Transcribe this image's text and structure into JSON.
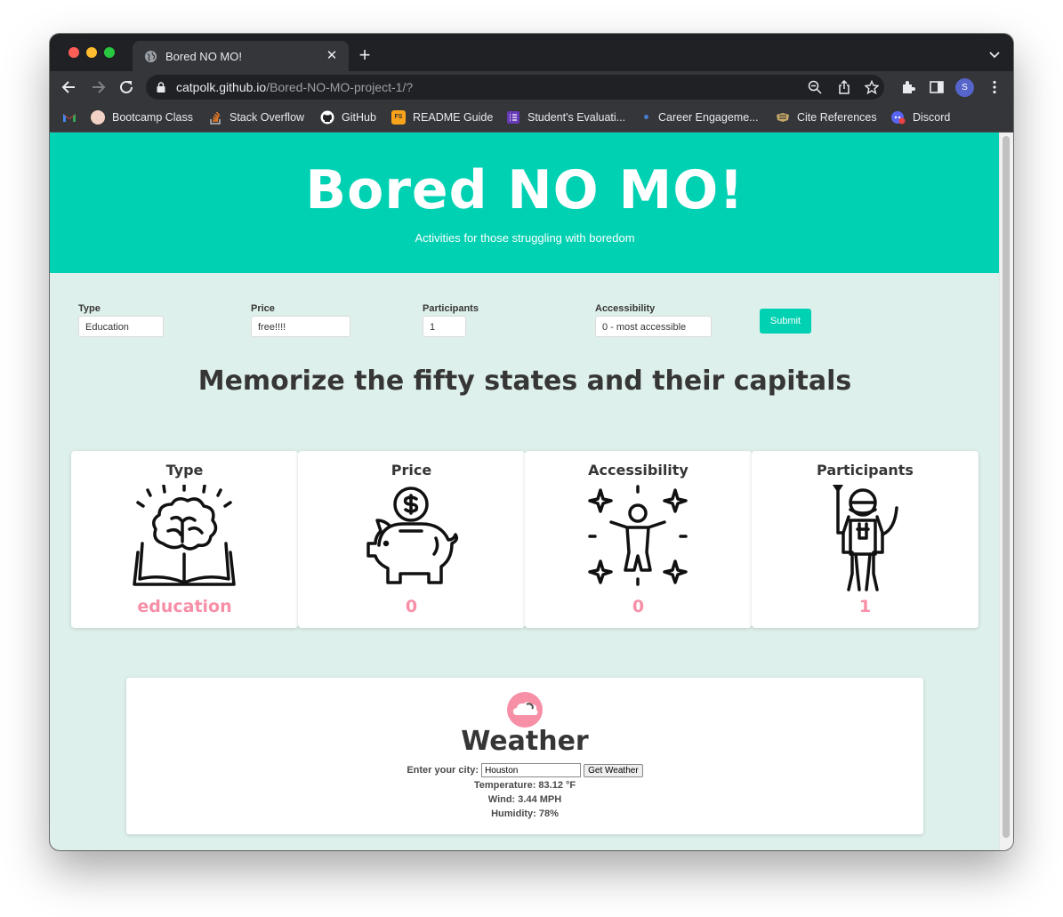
{
  "browser": {
    "tab_title": "Bored NO MO!",
    "url_host": "catpolk.github.io",
    "url_path": "/Bored-NO-MO-project-1/?",
    "profile_initial": "S",
    "bookmarks": [
      {
        "label": "",
        "icon": "gmail-icon"
      },
      {
        "label": "Bootcamp Class",
        "icon": "bootcamp-icon"
      },
      {
        "label": "Stack Overflow",
        "icon": "stackoverflow-icon"
      },
      {
        "label": "GitHub",
        "icon": "github-icon"
      },
      {
        "label": "README Guide",
        "icon": "readme-icon"
      },
      {
        "label": "Student's Evaluati...",
        "icon": "forms-icon"
      },
      {
        "label": "Career Engageme...",
        "icon": "career-icon"
      },
      {
        "label": "Cite References",
        "icon": "cite-icon"
      },
      {
        "label": "Discord",
        "icon": "discord-icon"
      }
    ]
  },
  "hero": {
    "title": "Bored NO MO!",
    "subtitle": "Activities for those struggling with boredom"
  },
  "filters": {
    "type_label": "Type",
    "type_value": "Education",
    "price_label": "Price",
    "price_value": "free!!!!",
    "participants_label": "Participants",
    "participants_value": "1",
    "accessibility_label": "Accessibility",
    "accessibility_value": "0 - most accessible",
    "submit_label": "Submit"
  },
  "activity": {
    "title": "Memorize the fifty states and their capitals"
  },
  "cards": [
    {
      "title": "Type",
      "value": "education",
      "icon": "brain-book-icon"
    },
    {
      "title": "Price",
      "value": "0",
      "icon": "piggy-bank-icon"
    },
    {
      "title": "Accessibility",
      "value": "0",
      "icon": "sparkle-person-icon"
    },
    {
      "title": "Participants",
      "value": "1",
      "icon": "astronaut-icon"
    }
  ],
  "weather": {
    "title": "Weather",
    "city_label": "Enter your city:",
    "city_value": "Houston",
    "button_label": "Get Weather",
    "temperature": "Temperature: 83.12 °F",
    "wind": "Wind: 3.44 MPH",
    "humidity": "Humidity: 78%"
  },
  "colors": {
    "brand_teal": "#00d1b2",
    "page_bg": "#def0eb",
    "accent_pink": "#f78fa7",
    "text_dark": "#363636"
  }
}
